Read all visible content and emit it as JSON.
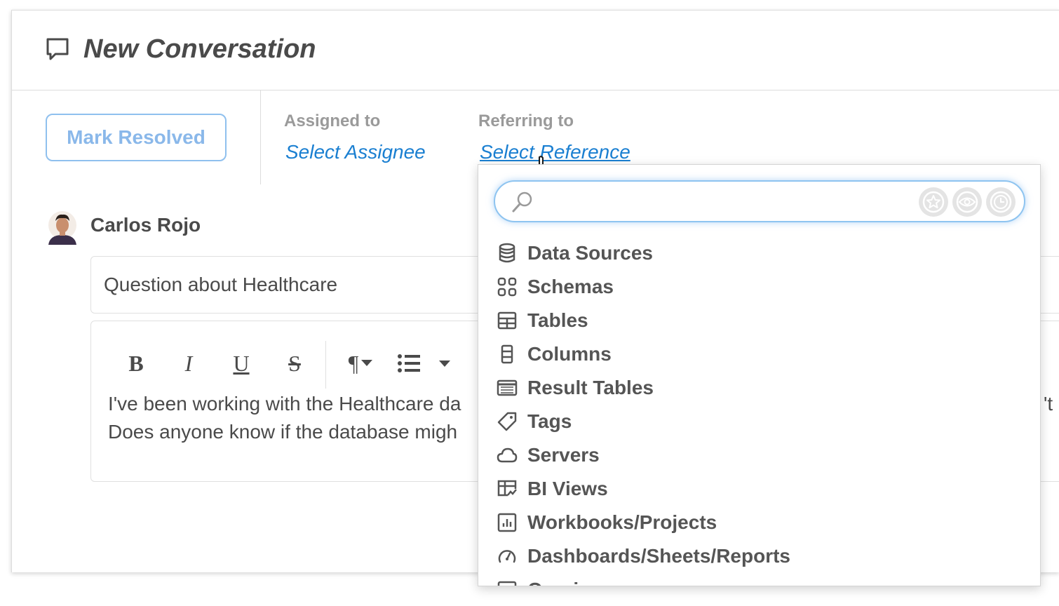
{
  "header": {
    "title": "New Conversation",
    "icon": "chat-bubble-icon"
  },
  "actions": {
    "mark_resolved_label": "Mark Resolved"
  },
  "assigned": {
    "label": "Assigned to",
    "value": "Select Assignee"
  },
  "referring": {
    "label": "Referring to",
    "value": "Select Reference"
  },
  "message": {
    "author": "Carlos Rojo",
    "subject": "Question about Healthcare",
    "toolbar": [
      "B",
      "I",
      "U",
      "S",
      "¶",
      "list",
      "more"
    ],
    "body_line1": "I've been working with the Healthcare da",
    "body_line1_tail": "'t",
    "body_line2": "Does anyone know if the database migh"
  },
  "reference_dropdown": {
    "search_placeholder": "",
    "filters": [
      "star-icon",
      "eye-icon",
      "clock-icon"
    ],
    "items": [
      {
        "label": "Data Sources",
        "icon": "database-icon"
      },
      {
        "label": "Schemas",
        "icon": "schema-icon"
      },
      {
        "label": "Tables",
        "icon": "table-icon"
      },
      {
        "label": "Columns",
        "icon": "column-icon"
      },
      {
        "label": "Result Tables",
        "icon": "result-table-icon"
      },
      {
        "label": "Tags",
        "icon": "tag-icon"
      },
      {
        "label": "Servers",
        "icon": "cloud-icon"
      },
      {
        "label": "BI Views",
        "icon": "bi-view-icon"
      },
      {
        "label": "Workbooks/Projects",
        "icon": "workbook-icon"
      },
      {
        "label": "Dashboards/Sheets/Reports",
        "icon": "dashboard-icon"
      },
      {
        "label": "Queries",
        "icon": "query-icon"
      }
    ]
  },
  "colors": {
    "link": "#1a7fd1",
    "button_border": "#8fc0ee",
    "focus_glow": "#8ec4f0"
  }
}
